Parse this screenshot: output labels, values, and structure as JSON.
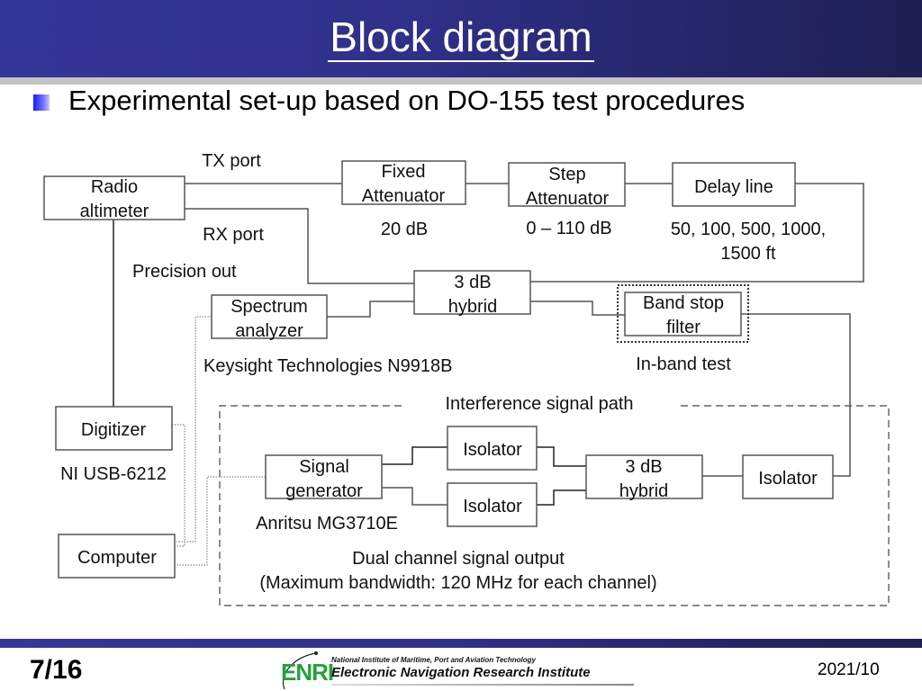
{
  "header": {
    "title": "Block diagram",
    "subtitle": "Experimental set-up based on DO-155 test procedures"
  },
  "diagram": {
    "blocks": {
      "radio_altimeter": [
        "Radio",
        "altimeter"
      ],
      "fixed_attenuator": [
        "Fixed",
        "Attenuator"
      ],
      "step_attenuator": [
        "Step",
        "Attenuator"
      ],
      "delay_line": "Delay line",
      "hybrid_top": [
        "3 dB",
        "hybrid"
      ],
      "spectrum_analyzer": [
        "Spectrum",
        "analyzer"
      ],
      "band_stop_filter": [
        "Band stop",
        "filter"
      ],
      "digitizer": "Digitizer",
      "computer": "Computer",
      "signal_generator": [
        "Signal",
        "generator"
      ],
      "isolator_top": "Isolator",
      "isolator_bottom": "Isolator",
      "hybrid_bottom": [
        "3 dB",
        "hybrid"
      ],
      "isolator_right": "Isolator"
    },
    "labels": {
      "tx_port": "TX port",
      "rx_port": "RX port",
      "precision_out": "Precision out",
      "fixed_att_value": "20 dB",
      "step_att_value": "0 – 110 dB",
      "delay_values": [
        "50, 100, 500, 1000,",
        "1500 ft"
      ],
      "spectrum_model": "Keysight Technologies N9918B",
      "in_band_test": "In-band test",
      "interference_path": "Interference signal path",
      "digitizer_model": "NI USB-6212",
      "generator_model": "Anritsu MG3710E",
      "dual_channel": [
        "Dual channel signal output",
        "(Maximum bandwidth: 120 MHz for each channel)"
      ]
    }
  },
  "footer": {
    "page": "7/16",
    "date": "2021/10",
    "logo": {
      "acronym": "ENRI",
      "small_text": "National Institute of Maritime, Port and Aviation Technology",
      "big_text": "Electronic Navigation Research Institute"
    }
  }
}
